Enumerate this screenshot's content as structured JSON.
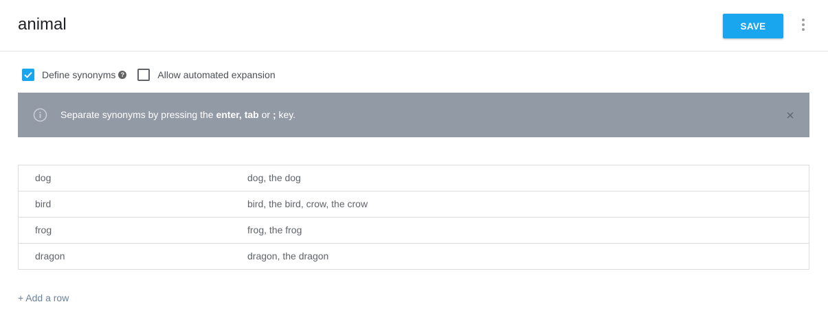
{
  "header": {
    "title": "animal",
    "save_label": "SAVE",
    "more_icon": "more-vert-icon"
  },
  "options": {
    "define_synonyms": {
      "label": "Define synonyms",
      "checked": true
    },
    "automated_expansion": {
      "label": "Allow automated expansion",
      "checked": false
    }
  },
  "banner": {
    "text_before": "Separate synonyms by pressing the ",
    "key_enter": "enter,",
    "text_between1": " ",
    "key_tab": "tab",
    "text_between2": " or ",
    "key_semicolon": ";",
    "text_after": " key.",
    "background_color": "#929aa6"
  },
  "table": {
    "rows": [
      {
        "value": "dog",
        "synonyms": "dog, the dog"
      },
      {
        "value": "bird",
        "synonyms": "bird, the bird, crow, the crow"
      },
      {
        "value": "frog",
        "synonyms": "frog, the frog"
      },
      {
        "value": "dragon",
        "synonyms": "dragon, the dragon"
      }
    ]
  },
  "add_row_label": "+ Add a row",
  "colors": {
    "accent": "#1aa6ef"
  }
}
